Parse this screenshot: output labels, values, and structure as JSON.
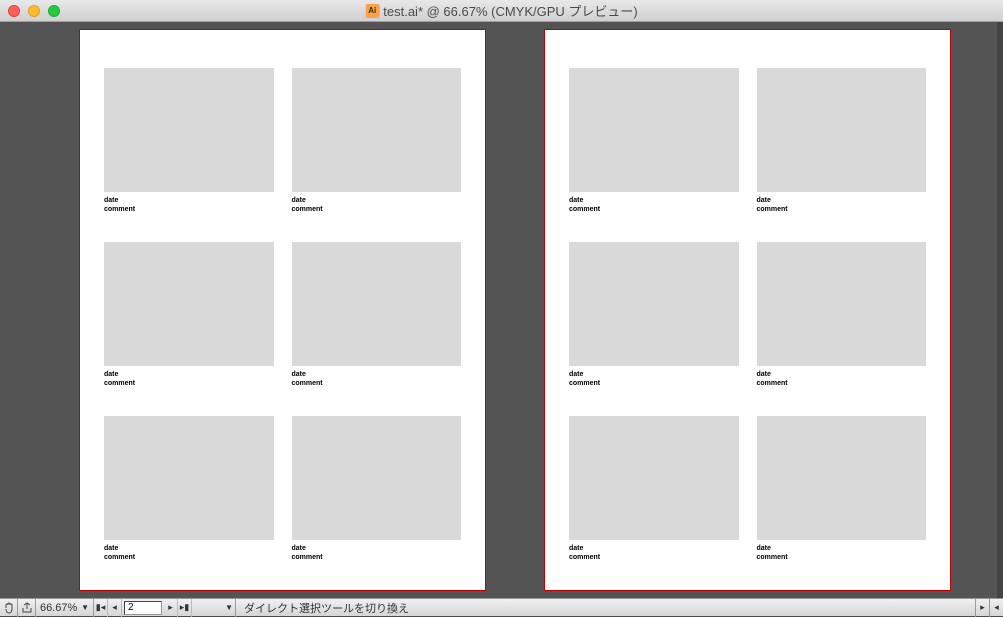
{
  "window": {
    "title": "test.ai* @ 66.67% (CMYK/GPU プレビュー)",
    "file_icon": "Ai"
  },
  "artboards": [
    {
      "cells": [
        {
          "date_label": "date",
          "comment_label": "comment"
        },
        {
          "date_label": "date",
          "comment_label": "comment"
        },
        {
          "date_label": "date",
          "comment_label": "comment"
        },
        {
          "date_label": "date",
          "comment_label": "comment"
        },
        {
          "date_label": "date",
          "comment_label": "comment"
        },
        {
          "date_label": "date",
          "comment_label": "comment"
        }
      ]
    },
    {
      "cells": [
        {
          "date_label": "date",
          "comment_label": "comment"
        },
        {
          "date_label": "date",
          "comment_label": "comment"
        },
        {
          "date_label": "date",
          "comment_label": "comment"
        },
        {
          "date_label": "date",
          "comment_label": "comment"
        },
        {
          "date_label": "date",
          "comment_label": "comment"
        },
        {
          "date_label": "date",
          "comment_label": "comment"
        }
      ]
    }
  ],
  "statusbar": {
    "zoom": "66.67%",
    "page": "2",
    "tool_hint": "ダイレクト選択ツールを切り換え"
  }
}
